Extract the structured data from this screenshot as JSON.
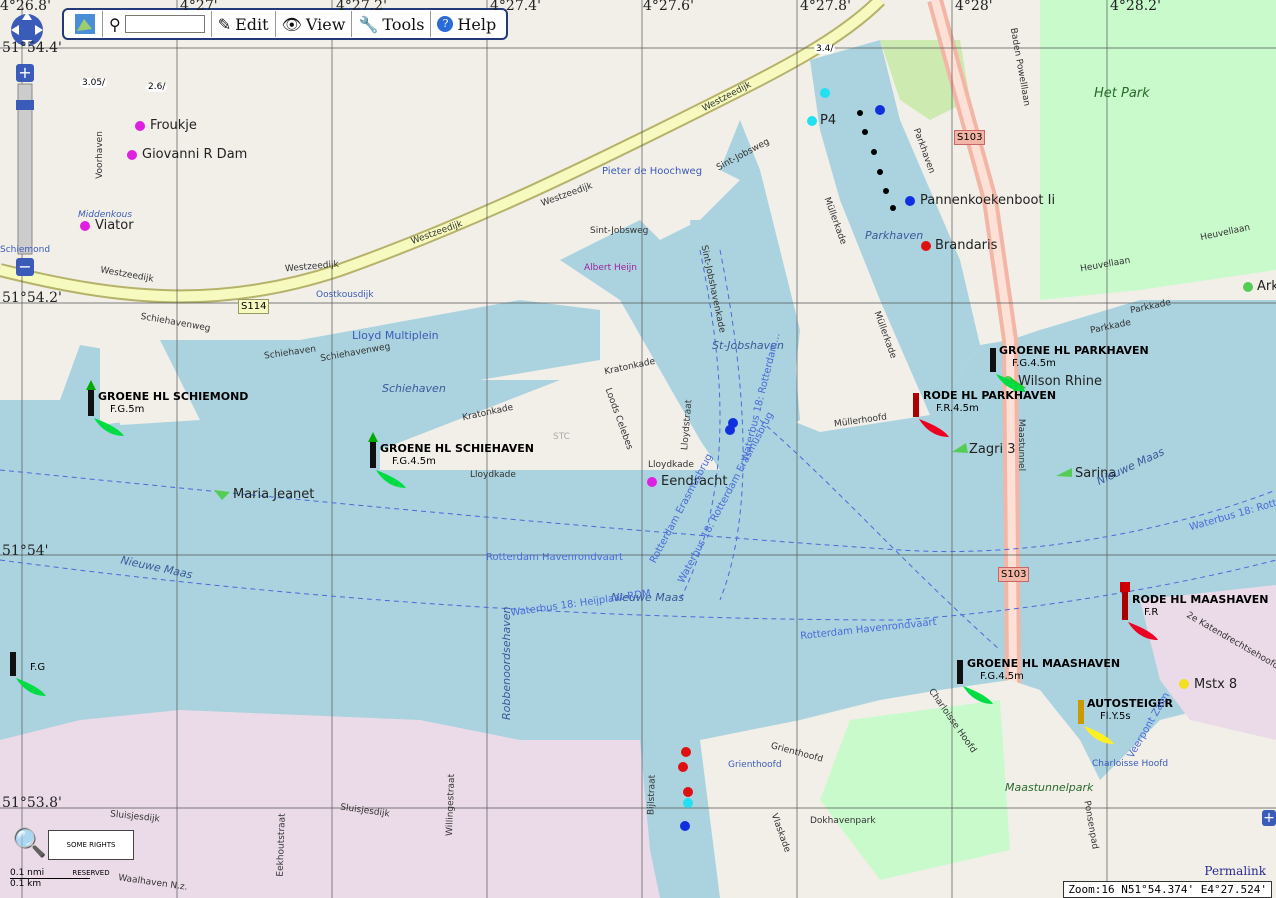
{
  "toolbar": {
    "search_value": "",
    "edit_label": "Edit",
    "view_label": "View",
    "tools_label": "Tools",
    "help_label": "Help"
  },
  "grid": {
    "lon_labels": [
      "4°26.8'",
      "4°27'",
      "4°27.2'",
      "4°27.4'",
      "4°27.6'",
      "4°27.8'",
      "4°28'",
      "4°28.2'"
    ],
    "lat_labels": [
      "51°54.4'",
      "51°54.2'",
      "51°54'",
      "51°53.8'"
    ]
  },
  "vessels": [
    "Froukje",
    "Giovanni R Dam",
    "Viator",
    "P4",
    "Pannenkoekenboot Ii",
    "Brandaris",
    "Maria Jeanet",
    "Eendracht",
    "Zagri 3",
    "Sarina",
    "Wilson Rhine",
    "Mstx 8",
    "Ark"
  ],
  "lights": [
    {
      "name": "GROENE HL SCHIEMOND",
      "char": "F.G.5m"
    },
    {
      "name": "GROENE HL SCHIEHAVEN",
      "char": "F.G.4.5m"
    },
    {
      "name": "GROENE HL PARKHAVEN",
      "char": "F.G.4.5m"
    },
    {
      "name": "RODE HL PARKHAVEN",
      "char": "F.R.4.5m"
    },
    {
      "name": "RODE HL MAASHAVEN",
      "char": "F.R"
    },
    {
      "name": "GROENE HL MAASHAVEN",
      "char": "F.G.4.5m"
    },
    {
      "name": "AUTOSTEIGER",
      "char": "Fl.Y.5s"
    },
    {
      "name": "",
      "char": "F.G"
    }
  ],
  "places": {
    "het_park": "Het Park",
    "parkhaven": "Parkhaven",
    "schiehaven": "Schiehaven",
    "st_jobshaven": "St-Jobshaven",
    "nieuwe_maas_1": "Nieuwe Maas",
    "nieuwe_maas_2": "Nieuwe Maas",
    "nieuwe_maas_3": "Nieuwe Maas",
    "maastunnelpark": "Maastunnelpark",
    "robbenoordsehaven": "Robbenoordsehaven",
    "albert_heijn": "Albert Heijn",
    "lloyd_multiplein": "Lloyd Multiplein",
    "pieter_de_hoochweg": "Pieter de Hoochweg",
    "middenkous": "Middenkous",
    "oostkousdijk": "Oostkousdijk",
    "grienthoofd_p": "Grienthoofd",
    "charloisse_hoofd": "Charloisse Hoofd",
    "s103_a": "S103",
    "s103_b": "S103",
    "s114": "S114",
    "schiemond": "Schiemond",
    "stc": "STC"
  },
  "streets": {
    "westzeedijk_1": "Westzeedijk",
    "westzeedijk_2": "Westzeedijk",
    "westzeedijk_3": "Westzeedijk",
    "westzeedijk_4": "Westzeedijk",
    "westzeedijk_5": "Westzeedijk",
    "schiehavenweg_1": "Schiehavenweg",
    "schiehavenweg_2": "Schiehavenweg",
    "lloydkade": "Lloydkade",
    "lloydkade_2": "Lloydkade",
    "kratonkade": "Kratonkade",
    "kratonkade_2": "Kratonkade",
    "sint_jobsweg": "Sint-Jobsweg",
    "sint_jobsweg_2": "Sint-Jobsweg",
    "mullerkade": "Müllerkade",
    "mullerkade_2": "Müllerkade",
    "mullerhoofd": "Müllerhoofd",
    "parkhaven_st": "Parkhaven",
    "parkkade": "Parkkade",
    "parkkade_2": "Parkkade",
    "heuvellaan": "Heuvellaan",
    "heuvellaan_2": "Heuvellaan",
    "baden_powelllaan": "Baden Powelllaan",
    "maastunnel": "Maastunnel",
    "sluisjesdijk": "Sluisjesdijk",
    "sluisjesdijk_2": "Sluisjesdijk",
    "waalhaven": "Waalhaven N.z.",
    "bijlstraat": "Bijlstraat",
    "grienthoofd": "Grienthoofd",
    "dokhavenpark": "Dokhavenpark",
    "charloisse": "Charloisse Hoofd",
    "schiehaven_st": "Schiehaven",
    "lloydstraat": "Lloydstraat",
    "loods_celebes": "Loods Celebes",
    "voorhaven": "Voorhaven",
    "sint_jobshavenkade": "Sint-Jobshavenkade",
    "eekhoutstraat": "Eekhoutstraat",
    "willingestraat": "Willingestraat",
    "vlaskade": "Vlaskade",
    "ponsenpad": "Ponsenpad",
    "katendrecht": "2e Katendrechtsehoofd",
    "veerpont": "Veerpont Zalm"
  },
  "waterways": {
    "havenrondvaart_1": "Rotterdam Havenrondvaart",
    "havenrondvaart_2": "Rotterdam Havenrondvaart",
    "waterbus_1": "Waterbus 18: Heijplaat-RDM",
    "waterbus_2": "Waterbus 18: Rotterdam Erasmusbrug",
    "waterbus_3": "Waterbus 18: Rotterdam-Erasmusbrug",
    "erasmusbrug": "Rotterdam Erasmusbrug",
    "waterbus_4": "Waterbus 18: Rotterdam..."
  },
  "clearances": [
    "3.05/",
    "2.6/",
    "3.4/"
  ],
  "footer": {
    "permalink": "Permalink",
    "status": "Zoom:16 N51°54.374' E4°27.524'",
    "scale_nmi": "0.1 nmi",
    "scale_km": "0.1 km",
    "cc_text": "SOME RIGHTS RESERVED"
  },
  "colors": {
    "water": "#aad3df",
    "land": "#f2efe9",
    "park": "#c8facc",
    "motorway": "#f7fabf",
    "industrial": "#ebdbe8",
    "ferry": "#4a6ad8",
    "green_light": "#00cc44",
    "red_light": "#ee0022"
  }
}
